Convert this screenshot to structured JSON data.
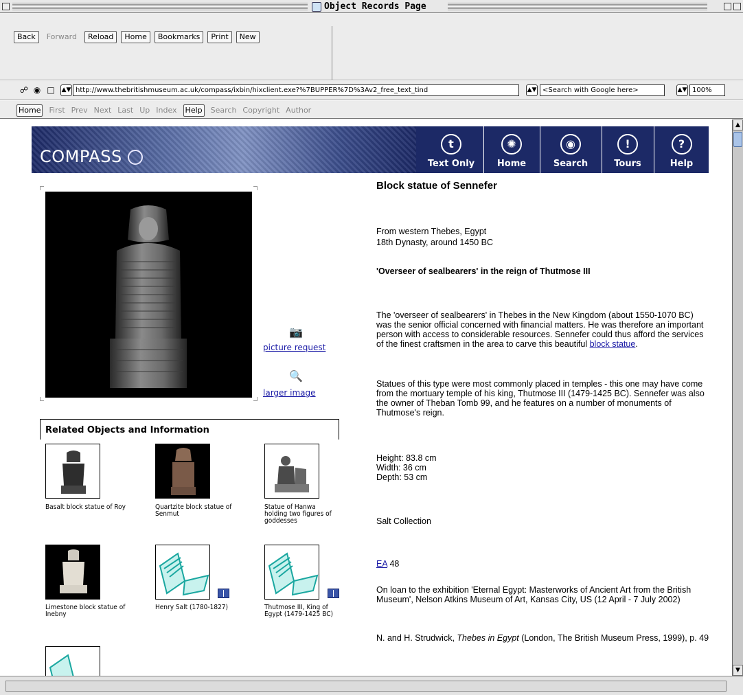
{
  "window": {
    "title": "Object Records Page"
  },
  "toolbar": {
    "buttons": [
      "Back",
      "Forward",
      "Reload",
      "Home",
      "Bookmarks",
      "Print",
      "New"
    ]
  },
  "address": {
    "url": "http://www.thebritishmuseum.ac.uk/compass/ixbin/hixclient.exe?%7BUPPER%7D%3Av2_free_text_tind",
    "search_placeholder": "<Search with Google here>",
    "zoom": "100%"
  },
  "navbar": {
    "items": [
      "Home",
      "First",
      "Prev",
      "Next",
      "Last",
      "Up",
      "Index",
      "Help",
      "Search",
      "Copyright",
      "Author"
    ]
  },
  "banner": {
    "logo": "COMPASS",
    "nav": [
      {
        "label": "Text Only",
        "icon": "t-circle-icon"
      },
      {
        "label": "Home",
        "icon": "sun-circle-icon"
      },
      {
        "label": "Search",
        "icon": "eye-circle-icon"
      },
      {
        "label": "Tours",
        "icon": "footsteps-circle-icon"
      },
      {
        "label": "Help",
        "icon": "question-circle-icon"
      }
    ]
  },
  "side_links": {
    "picture_request": "picture request",
    "larger_image": "larger image"
  },
  "related": {
    "heading": "Related Objects and Information",
    "items": [
      {
        "caption": "Basalt block statue of Roy"
      },
      {
        "caption": "Quartzite block statue of Senmut"
      },
      {
        "caption": "Statue of Hanwa holding two figures of goddesses"
      },
      {
        "caption": "Limestone block statue of Inebny"
      },
      {
        "caption": "Henry Salt (1780-1827)"
      },
      {
        "caption": "Thutmose III, King of Egypt (1479-1425 BC)"
      }
    ]
  },
  "record": {
    "title": "Block statue of Sennefer",
    "provenance_line1": "From western Thebes, Egypt",
    "provenance_line2": "18th Dynasty, around 1450 BC",
    "subtitle": "'Overseer of sealbearers' in the reign of Thutmose III",
    "para1_text": "The 'overseer of sealbearers' in Thebes in the New Kingdom (about 1550-1070 BC) was the senior official concerned with financial matters. He was therefore an important person with access to considerable resources. Sennefer could thus afford the services of the finest craftsmen in the area to carve this beautiful ",
    "para1_link": "block statue",
    "para1_end": ".",
    "para2": "Statues of this type were most commonly placed in temples - this one may have come from the mortuary temple of his king, Thutmose III (1479-1425 BC). Sennefer was also the owner of Theban Tomb 99, and he features on a number of monuments of Thutmose's reign.",
    "height": "Height: 83.8 cm",
    "width": "Width: 36 cm",
    "depth": "Depth: 53 cm",
    "collection": "Salt Collection",
    "reg_link": "EA",
    "reg_num": " 48",
    "loan": "On loan to the exhibition 'Eternal Egypt: Masterworks of Ancient Art from the British Museum', Nelson Atkins Museum of Art, Kansas City, US (12 April - 7 July 2002)",
    "ref_prefix": "N. and H. Strudwick, ",
    "ref_title": "Thebes in Egypt",
    "ref_suffix": " (London, The British Museum Press, 1999), p. 49"
  }
}
